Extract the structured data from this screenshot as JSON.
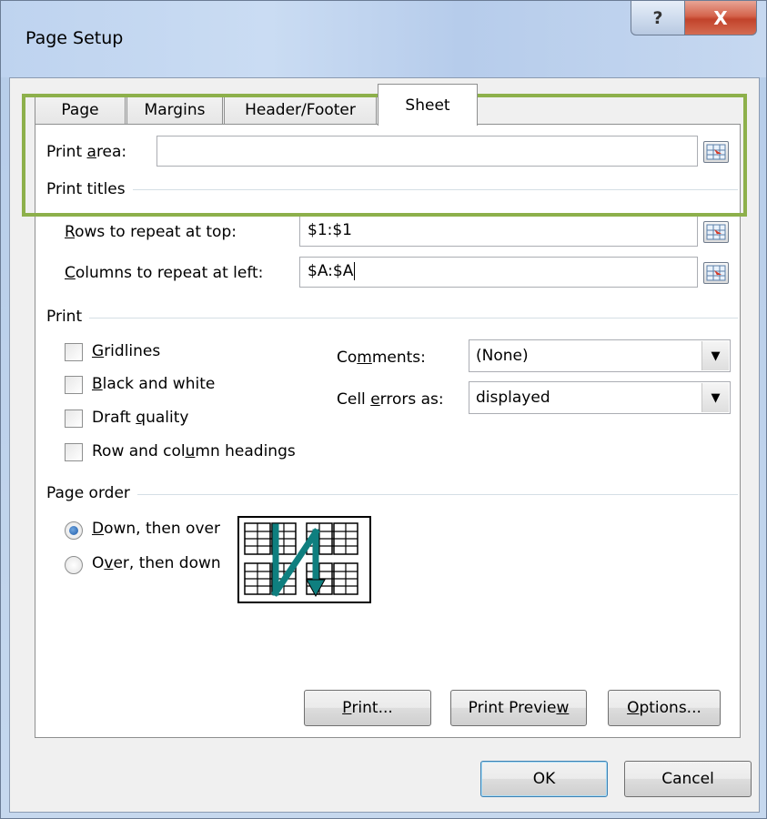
{
  "window": {
    "title": "Page Setup",
    "help_label": "?",
    "close_label": "X"
  },
  "tabs": [
    {
      "label": "Page",
      "active": false
    },
    {
      "label": "Margins",
      "active": false
    },
    {
      "label": "Header/Footer",
      "active": false
    },
    {
      "label": "Sheet",
      "active": true
    }
  ],
  "print_area": {
    "label_pre": "Print ",
    "label_key": "a",
    "label_post": "rea:",
    "value": ""
  },
  "print_titles": {
    "title": "Print titles",
    "rows": {
      "label_key": "R",
      "label_post": "ows to repeat at top:",
      "value": "$1:$1"
    },
    "columns": {
      "label_key": "C",
      "label_post": "olumns to repeat at left:",
      "value": "$A:$A"
    }
  },
  "print": {
    "title": "Print",
    "gridlines": {
      "label_key": "G",
      "label_post": "ridlines",
      "checked": false
    },
    "black_white": {
      "label_key": "B",
      "label_post": "lack and white",
      "checked": false
    },
    "draft": {
      "label_pre": "Draft ",
      "label_key": "q",
      "label_post": "uality",
      "checked": false
    },
    "headings": {
      "label_pre": "Row and col",
      "label_key": "u",
      "label_post": "mn headings",
      "checked": false
    },
    "comments": {
      "label_pre": "Co",
      "label_key": "m",
      "label_post": "ments:",
      "value": "(None)"
    },
    "cell_errors": {
      "label_pre": "Cell ",
      "label_key": "e",
      "label_post": "rrors as:",
      "value": "displayed"
    }
  },
  "page_order": {
    "title": "Page order",
    "down_then_over": {
      "label_key": "D",
      "label_post": "own, then over",
      "selected": true
    },
    "over_then_down": {
      "label_pre": "O",
      "label_key": "v",
      "label_post": "er, then down",
      "selected": false
    }
  },
  "buttons": {
    "print": {
      "label_key": "P",
      "label_post": "rint..."
    },
    "preview": {
      "label_pre": "Print Previe",
      "label_key": "w"
    },
    "options": {
      "label_key": "O",
      "label_post": "ptions..."
    },
    "ok": "OK",
    "cancel": "Cancel"
  },
  "colors": {
    "highlight": "#8db04b",
    "arrow": "#0f7f7f"
  },
  "icons": {
    "collapse": "collapse-dialog-icon",
    "dropdown": "chevron-down-icon"
  }
}
